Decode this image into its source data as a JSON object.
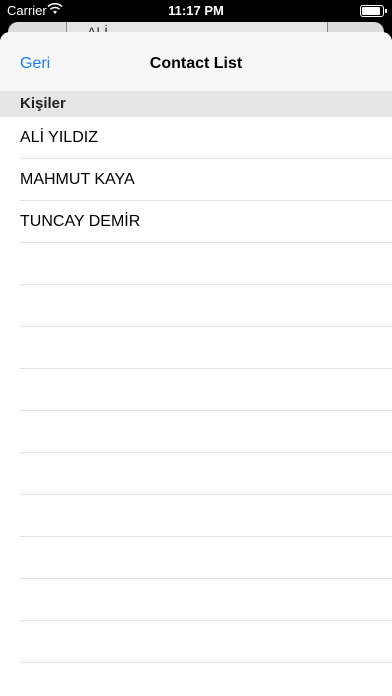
{
  "status_bar": {
    "carrier": "Carrier",
    "time": "11:17 PM",
    "wifi_icon": "wifi-icon",
    "battery_icon": "battery-icon"
  },
  "background_field_text": "ALİ",
  "nav": {
    "back_label": "Geri",
    "title": "Contact List"
  },
  "section": {
    "title": "Kişiler"
  },
  "contacts": [
    "ALİ YILDIZ",
    "MAHMUT KAYA",
    "TUNCAY DEMİR"
  ],
  "colors": {
    "accent": "#1a7ef2",
    "section_background": "#e6e6e6",
    "nav_background": "#f7f7f7"
  }
}
